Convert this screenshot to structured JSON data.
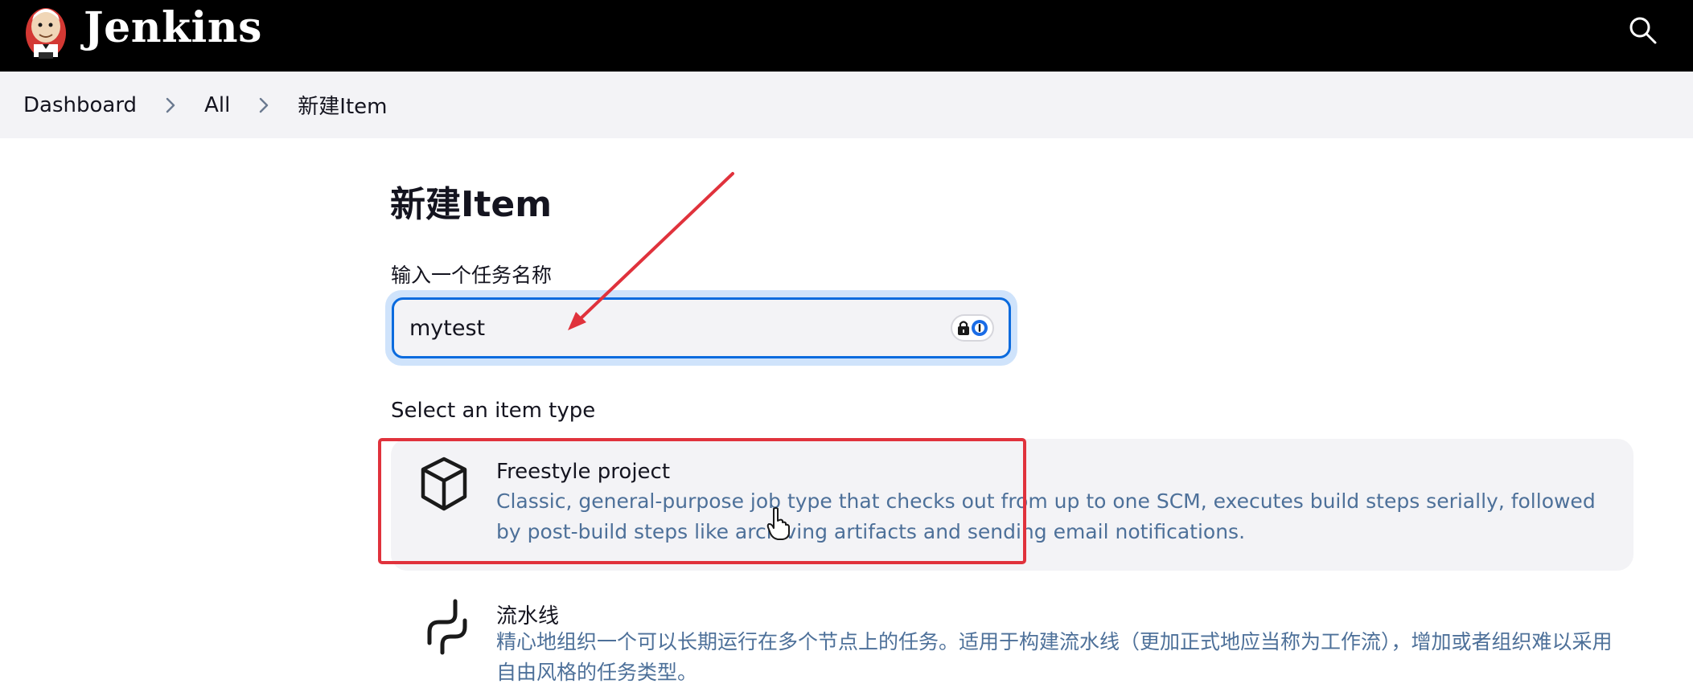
{
  "header": {
    "brand": "Jenkins",
    "logo_icon": "jenkins-butler-logo",
    "search_icon": "search-icon"
  },
  "breadcrumbs": [
    {
      "label": "Dashboard"
    },
    {
      "label": "All"
    },
    {
      "label": "新建Item"
    }
  ],
  "page": {
    "title": "新建Item",
    "name_label": "输入一个任务名称",
    "name_value": "mytest",
    "section_label": "Select an item type"
  },
  "item_types": [
    {
      "title": "Freestyle project",
      "description": "Classic, general-purpose job type that checks out from up to one SCM, executes build steps serially, followed by post-build steps like archiving artifacts and sending email notifications.",
      "icon": "package-cube-icon"
    },
    {
      "title": "流水线",
      "description": "精心地组织一个可以长期运行在多个节点上的任务。适用于构建流水线（更加正式地应当称为工作流），增加或者组织难以采用自由风格的任务类型。",
      "icon": "pipeline-icon"
    }
  ],
  "colors": {
    "header_bg": "#000000",
    "breadcrumb_bg": "#f3f3f6",
    "accent": "#0b6bde",
    "annotation": "#e0323c",
    "description_text": "#4d7099"
  }
}
